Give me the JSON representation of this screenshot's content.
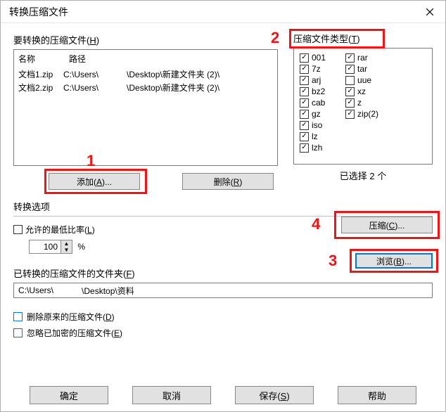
{
  "window": {
    "title": "转换压缩文件"
  },
  "annotations": {
    "n1": "1",
    "n2": "2",
    "n3": "3",
    "n4": "4"
  },
  "filelist": {
    "label_pre": "要转换的压缩文件(",
    "label_hot": "H",
    "label_post": ")",
    "col_name": "名称",
    "col_path": "路径",
    "rows": [
      {
        "name": "文档1.zip",
        "path_a": "C:\\Users\\",
        "path_b": "\\Desktop\\新建文件夹 (2)\\"
      },
      {
        "name": "文档2.zip",
        "path_a": "C:\\Users\\",
        "path_b": "\\Desktop\\新建文件夹 (2)\\"
      }
    ],
    "add_btn": "添加(A)...",
    "del_btn": "删除(R)"
  },
  "types": {
    "label_pre": "压缩文件类型(",
    "label_hot": "T",
    "label_post": ")",
    "col1": [
      {
        "label": "001",
        "checked": true
      },
      {
        "label": "7z",
        "checked": true
      },
      {
        "label": "arj",
        "checked": true
      },
      {
        "label": "bz2",
        "checked": true
      },
      {
        "label": "cab",
        "checked": true
      },
      {
        "label": "gz",
        "checked": true
      },
      {
        "label": "iso",
        "checked": true
      },
      {
        "label": "lz",
        "checked": true
      },
      {
        "label": "lzh",
        "checked": true
      }
    ],
    "col2": [
      {
        "label": "rar",
        "checked": true
      },
      {
        "label": "tar",
        "checked": true
      },
      {
        "label": "uue",
        "checked": false
      },
      {
        "label": "xz",
        "checked": true
      },
      {
        "label": "z",
        "checked": true
      },
      {
        "label": "zip(2)",
        "checked": true
      }
    ],
    "selected_text": "已选择 2 个"
  },
  "conv": {
    "section": "转换选项",
    "minrate": "允许的最低比率(L)",
    "minrate_val": "100",
    "pct": "%",
    "compress_btn": "压缩(C)...",
    "folder_label": "已转换的压缩文件的文件夹(F)",
    "folder_a": "C:\\Users\\",
    "folder_b": "\\Desktop\\资料",
    "browse_btn": "浏览(B)...",
    "del_orig": "删除原来的压缩文件(D)",
    "skip_enc": "忽略已加密的压缩文件(E)"
  },
  "buttons": {
    "ok": "确定",
    "cancel": "取消",
    "save": "保存(S)",
    "help": "帮助"
  }
}
